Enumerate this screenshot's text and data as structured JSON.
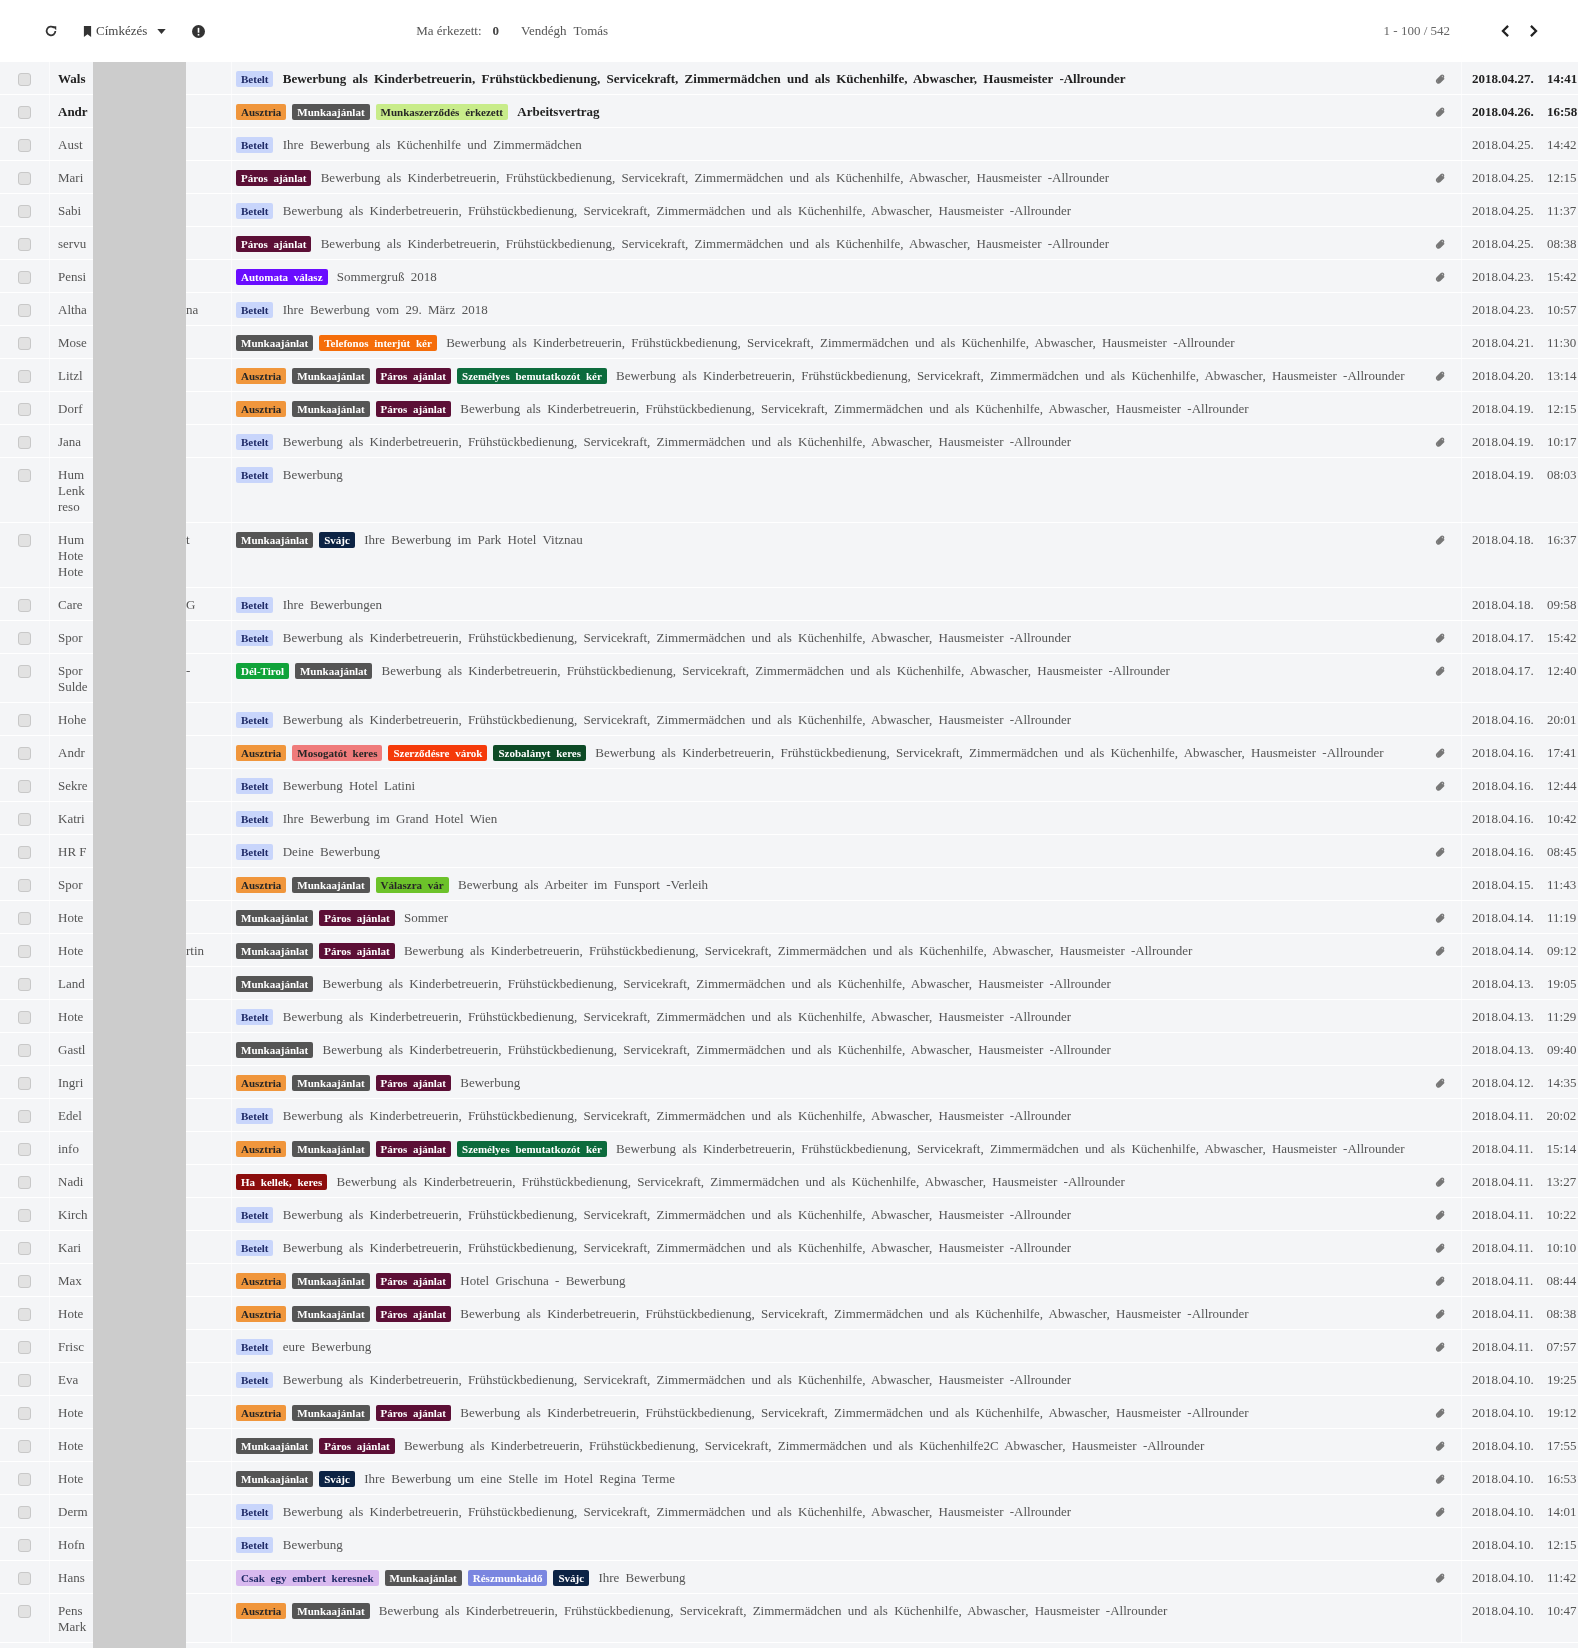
{
  "toolbar": {
    "label_menu": "Címkézés",
    "arrived_label": "Ma érkezett:",
    "arrived_count": "0",
    "user_name": "Vendégh Tomás",
    "pager": "1 - 100 / 542"
  },
  "rows": [
    {
      "sender_lines": [
        "Wals"
      ],
      "checked": false,
      "unread": true,
      "tags": [
        {
          "label": "Betelt",
          "color": "#c8d5fb"
        }
      ],
      "subject": "Bewerbung als Kinderbetreuerin, Frühstückbedienung, Servicekraft, Zimmermädchen und als Küchenhilfe, Abwascher, Hausmeister -Allrounder",
      "attachment": true,
      "date": "2018.04.27.",
      "time": "14:41"
    },
    {
      "sender_lines": [
        "Andr"
      ],
      "checked": false,
      "unread": true,
      "tags": [
        {
          "label": "Ausztria",
          "color": "#f0963c"
        },
        {
          "label": "Munkaajánlat",
          "color": "#555555"
        },
        {
          "label": "Munkaszerződés érkezett",
          "color": "#c8ec8a"
        }
      ],
      "subject": "Arbeitsvertrag",
      "attachment": true,
      "date": "2018.04.26.",
      "time": "16:58"
    },
    {
      "sender_lines": [
        "Aust"
      ],
      "checked": false,
      "unread": false,
      "tags": [
        {
          "label": "Betelt",
          "color": "#c8d5fb"
        }
      ],
      "subject": "Ihre Bewerbung als Küchenhilfe und Zimmermädchen",
      "attachment": false,
      "date": "2018.04.25.",
      "time": "14:42"
    },
    {
      "sender_lines": [
        "Mari"
      ],
      "checked": false,
      "unread": false,
      "tags": [
        {
          "label": "Páros ajánlat",
          "color": "#5c0f36"
        }
      ],
      "subject": "Bewerbung als Kinderbetreuerin, Frühstückbedienung, Servicekraft, Zimmermädchen und als Küchenhilfe, Abwascher, Hausmeister -Allrounder",
      "attachment": true,
      "date": "2018.04.25.",
      "time": "12:15"
    },
    {
      "sender_lines": [
        "Sabi"
      ],
      "checked": false,
      "unread": false,
      "tags": [
        {
          "label": "Betelt",
          "color": "#c8d5fb"
        }
      ],
      "subject": "Bewerbung als Kinderbetreuerin, Frühstückbedienung, Servicekraft, Zimmermädchen und als Küchenhilfe, Abwascher, Hausmeister -Allrounder",
      "attachment": false,
      "date": "2018.04.25.",
      "time": "11:37"
    },
    {
      "sender_lines": [
        "servu"
      ],
      "checked": false,
      "unread": false,
      "tags": [
        {
          "label": "Páros ajánlat",
          "color": "#5c0f36"
        }
      ],
      "subject": "Bewerbung als Kinderbetreuerin, Frühstückbedienung, Servicekraft, Zimmermädchen und als Küchenhilfe, Abwascher, Hausmeister -Allrounder",
      "attachment": true,
      "date": "2018.04.25.",
      "time": "08:38"
    },
    {
      "sender_lines": [
        "Pensi"
      ],
      "checked": false,
      "unread": false,
      "tags": [
        {
          "label": "Automata válasz",
          "color": "#6a0dff"
        }
      ],
      "subject": "Sommergruß 2018",
      "attachment": true,
      "date": "2018.04.23.",
      "time": "15:42"
    },
    {
      "sender_lines": [
        "Altha"
      ],
      "sender_tail": "na",
      "checked": false,
      "unread": false,
      "tags": [
        {
          "label": "Betelt",
          "color": "#c8d5fb"
        }
      ],
      "subject": "Ihre Bewerbung vom 29. März 2018",
      "attachment": false,
      "date": "2018.04.23.",
      "time": "10:57"
    },
    {
      "sender_lines": [
        "Mose"
      ],
      "checked": false,
      "unread": false,
      "tags": [
        {
          "label": "Munkaajánlat",
          "color": "#555555"
        },
        {
          "label": "Telefonos interjút kér",
          "color": "#f56d0a"
        }
      ],
      "subject": "Bewerbung als Kinderbetreuerin, Frühstückbedienung, Servicekraft, Zimmermädchen und als Küchenhilfe, Abwascher, Hausmeister -Allrounder",
      "attachment": false,
      "date": "2018.04.21.",
      "time": "11:30"
    },
    {
      "sender_lines": [
        "Litzl"
      ],
      "checked": false,
      "unread": false,
      "tags": [
        {
          "label": "Ausztria",
          "color": "#f0963c"
        },
        {
          "label": "Munkaajánlat",
          "color": "#555555"
        },
        {
          "label": "Páros ajánlat",
          "color": "#5c0f36"
        },
        {
          "label": "Személyes bemutatkozót kér",
          "color": "#0c6b3c"
        }
      ],
      "subject": "Bewerbung als Kinderbetreuerin, Frühstückbedienung, Servicekraft, Zimmermädchen und als Küchenhilfe, Abwascher, Hausmeister -Allrounder",
      "attachment": true,
      "date": "2018.04.20.",
      "time": "13:14"
    },
    {
      "sender_lines": [
        "Dorf"
      ],
      "checked": false,
      "unread": false,
      "tags": [
        {
          "label": "Ausztria",
          "color": "#f0963c"
        },
        {
          "label": "Munkaajánlat",
          "color": "#555555"
        },
        {
          "label": "Páros ajánlat",
          "color": "#5c0f36"
        }
      ],
      "subject": "Bewerbung als Kinderbetreuerin, Frühstückbedienung, Servicekraft, Zimmermädchen und als Küchenhilfe, Abwascher, Hausmeister -Allrounder",
      "attachment": false,
      "date": "2018.04.19.",
      "time": "12:15"
    },
    {
      "sender_lines": [
        "Jana"
      ],
      "checked": false,
      "unread": false,
      "tags": [
        {
          "label": "Betelt",
          "color": "#c8d5fb"
        }
      ],
      "subject": "Bewerbung als Kinderbetreuerin, Frühstückbedienung, Servicekraft, Zimmermädchen und als Küchenhilfe, Abwascher, Hausmeister -Allrounder",
      "attachment": true,
      "date": "2018.04.19.",
      "time": "10:17"
    },
    {
      "sender_lines": [
        "Hum",
        "Lenk",
        "reso"
      ],
      "checked": false,
      "unread": false,
      "tags": [
        {
          "label": "Betelt",
          "color": "#c8d5fb"
        }
      ],
      "subject": "Bewerbung",
      "attachment": false,
      "date": "2018.04.19.",
      "time": "08:03"
    },
    {
      "sender_lines": [
        "Hum",
        "Hote",
        "Hote"
      ],
      "sender_tail": "t",
      "checked": false,
      "unread": false,
      "tags": [
        {
          "label": "Munkaajánlat",
          "color": "#555555"
        },
        {
          "label": "Svájc",
          "color": "#0c2344"
        }
      ],
      "subject": "Ihre Bewerbung im Park Hotel Vitznau",
      "attachment": true,
      "date": "2018.04.18.",
      "time": "16:37"
    },
    {
      "sender_lines": [
        "Care"
      ],
      "sender_tail": "G",
      "checked": false,
      "unread": false,
      "tags": [
        {
          "label": "Betelt",
          "color": "#c8d5fb"
        }
      ],
      "subject": "Ihre Bewerbungen",
      "attachment": false,
      "date": "2018.04.18.",
      "time": "09:58"
    },
    {
      "sender_lines": [
        "Spor"
      ],
      "checked": false,
      "unread": false,
      "tags": [
        {
          "label": "Betelt",
          "color": "#c8d5fb"
        }
      ],
      "subject": "Bewerbung als Kinderbetreuerin, Frühstückbedienung, Servicekraft, Zimmermädchen und als Küchenhilfe, Abwascher, Hausmeister -Allrounder",
      "attachment": true,
      "date": "2018.04.17.",
      "time": "15:42"
    },
    {
      "sender_lines": [
        "Spor",
        "Sulde"
      ],
      "sender_tail": "-",
      "checked": false,
      "unread": false,
      "tags": [
        {
          "label": "Dél-Tirol",
          "color": "#10a33a"
        },
        {
          "label": "Munkaajánlat",
          "color": "#555555"
        }
      ],
      "subject": "Bewerbung als Kinderbetreuerin, Frühstückbedienung, Servicekraft, Zimmermädchen und als Küchenhilfe, Abwascher, Hausmeister -Allrounder",
      "attachment": true,
      "date": "2018.04.17.",
      "time": "12:40"
    },
    {
      "sender_lines": [
        "Hohe"
      ],
      "checked": false,
      "unread": false,
      "tags": [
        {
          "label": "Betelt",
          "color": "#c8d5fb"
        }
      ],
      "subject": "Bewerbung als Kinderbetreuerin, Frühstückbedienung, Servicekraft, Zimmermädchen und als Küchenhilfe, Abwascher, Hausmeister -Allrounder",
      "attachment": false,
      "date": "2018.04.16.",
      "time": "20:01"
    },
    {
      "sender_lines": [
        "Andr"
      ],
      "checked": false,
      "unread": false,
      "tags": [
        {
          "label": "Ausztria",
          "color": "#f0963c"
        },
        {
          "label": "Mosogatót keres",
          "color": "#ef7b7b"
        },
        {
          "label": "Szerződésre várok",
          "color": "#f53a0a"
        },
        {
          "label": "Szobalányt keres",
          "color": "#0d4a26"
        }
      ],
      "subject": "Bewerbung als Kinderbetreuerin, Frühstückbedienung, Servicekraft, Zimmermädchen und als Küchenhilfe, Abwascher, Hausmeister -Allrounder",
      "attachment": true,
      "date": "2018.04.16.",
      "time": "17:41"
    },
    {
      "sender_lines": [
        "Sekre"
      ],
      "checked": false,
      "unread": false,
      "tags": [
        {
          "label": "Betelt",
          "color": "#c8d5fb"
        }
      ],
      "subject": "Bewerbung Hotel Latini",
      "attachment": true,
      "date": "2018.04.16.",
      "time": "12:44"
    },
    {
      "sender_lines": [
        "Katri"
      ],
      "checked": false,
      "unread": false,
      "tags": [
        {
          "label": "Betelt",
          "color": "#c8d5fb"
        }
      ],
      "subject": "Ihre Bewerbung im Grand Hotel Wien",
      "attachment": false,
      "date": "2018.04.16.",
      "time": "10:42"
    },
    {
      "sender_lines": [
        "HR F"
      ],
      "checked": false,
      "unread": false,
      "tags": [
        {
          "label": "Betelt",
          "color": "#c8d5fb"
        }
      ],
      "subject": "Deine Bewerbung",
      "attachment": true,
      "date": "2018.04.16.",
      "time": "08:45"
    },
    {
      "sender_lines": [
        "Spor"
      ],
      "checked": false,
      "unread": false,
      "tags": [
        {
          "label": "Ausztria",
          "color": "#f0963c"
        },
        {
          "label": "Munkaajánlat",
          "color": "#555555"
        },
        {
          "label": "Válaszra vár",
          "color": "#6cc22a"
        }
      ],
      "subject": "Bewerbung als Arbeiter im Funsport -Verleih",
      "attachment": false,
      "date": "2018.04.15.",
      "time": "11:43"
    },
    {
      "sender_lines": [
        "Hote"
      ],
      "checked": false,
      "unread": false,
      "tags": [
        {
          "label": "Munkaajánlat",
          "color": "#555555"
        },
        {
          "label": "Páros ajánlat",
          "color": "#5c0f36"
        }
      ],
      "subject": "Sommer",
      "attachment": true,
      "date": "2018.04.14.",
      "time": "11:19"
    },
    {
      "sender_lines": [
        "Hote"
      ],
      "sender_tail": "rtin",
      "checked": false,
      "unread": false,
      "tags": [
        {
          "label": "Munkaajánlat",
          "color": "#555555"
        },
        {
          "label": "Páros ajánlat",
          "color": "#5c0f36"
        }
      ],
      "subject": "Bewerbung als Kinderbetreuerin, Frühstückbedienung, Servicekraft, Zimmermädchen und als Küchenhilfe, Abwascher, Hausmeister -Allrounder",
      "attachment": true,
      "date": "2018.04.14.",
      "time": "09:12"
    },
    {
      "sender_lines": [
        "Land"
      ],
      "checked": false,
      "unread": false,
      "tags": [
        {
          "label": "Munkaajánlat",
          "color": "#555555"
        }
      ],
      "subject": "Bewerbung als Kinderbetreuerin, Frühstückbedienung, Servicekraft, Zimmermädchen und als Küchenhilfe, Abwascher, Hausmeister -Allrounder",
      "attachment": false,
      "date": "2018.04.13.",
      "time": "19:05"
    },
    {
      "sender_lines": [
        "Hote"
      ],
      "checked": false,
      "unread": false,
      "tags": [
        {
          "label": "Betelt",
          "color": "#c8d5fb"
        }
      ],
      "subject": "Bewerbung als Kinderbetreuerin, Frühstückbedienung, Servicekraft, Zimmermädchen und als Küchenhilfe, Abwascher, Hausmeister -Allrounder",
      "attachment": false,
      "date": "2018.04.13.",
      "time": "11:29"
    },
    {
      "sender_lines": [
        "Gastl"
      ],
      "checked": false,
      "unread": false,
      "tags": [
        {
          "label": "Munkaajánlat",
          "color": "#555555"
        }
      ],
      "subject": "Bewerbung als Kinderbetreuerin, Frühstückbedienung, Servicekraft, Zimmermädchen und als Küchenhilfe, Abwascher, Hausmeister -Allrounder",
      "attachment": false,
      "date": "2018.04.13.",
      "time": "09:40"
    },
    {
      "sender_lines": [
        "Ingri"
      ],
      "checked": false,
      "unread": false,
      "tags": [
        {
          "label": "Ausztria",
          "color": "#f0963c"
        },
        {
          "label": "Munkaajánlat",
          "color": "#555555"
        },
        {
          "label": "Páros ajánlat",
          "color": "#5c0f36"
        }
      ],
      "subject": "Bewerbung",
      "attachment": true,
      "date": "2018.04.12.",
      "time": "14:35"
    },
    {
      "sender_lines": [
        "Edel"
      ],
      "checked": false,
      "unread": false,
      "tags": [
        {
          "label": "Betelt",
          "color": "#c8d5fb"
        }
      ],
      "subject": "Bewerbung als Kinderbetreuerin, Frühstückbedienung, Servicekraft, Zimmermädchen und als Küchenhilfe, Abwascher, Hausmeister -Allrounder",
      "attachment": false,
      "date": "2018.04.11.",
      "time": "20:02"
    },
    {
      "sender_lines": [
        "info"
      ],
      "checked": false,
      "unread": false,
      "tags": [
        {
          "label": "Ausztria",
          "color": "#f0963c"
        },
        {
          "label": "Munkaajánlat",
          "color": "#555555"
        },
        {
          "label": "Páros ajánlat",
          "color": "#5c0f36"
        },
        {
          "label": "Személyes bemutatkozót kér",
          "color": "#0c6b3c"
        }
      ],
      "subject": "Bewerbung als Kinderbetreuerin, Frühstückbedienung, Servicekraft, Zimmermädchen und als Küchenhilfe, Abwascher, Hausmeister -Allrounder",
      "attachment": false,
      "date": "2018.04.11.",
      "time": "15:14"
    },
    {
      "sender_lines": [
        "Nadi"
      ],
      "checked": false,
      "unread": false,
      "tags": [
        {
          "label": "Ha kellek, keres",
          "color": "#8c0d0d"
        }
      ],
      "subject": "Bewerbung als Kinderbetreuerin, Frühstückbedienung, Servicekraft, Zimmermädchen und als Küchenhilfe, Abwascher, Hausmeister -Allrounder",
      "attachment": true,
      "date": "2018.04.11.",
      "time": "13:27"
    },
    {
      "sender_lines": [
        "Kirch"
      ],
      "checked": false,
      "unread": false,
      "tags": [
        {
          "label": "Betelt",
          "color": "#c8d5fb"
        }
      ],
      "subject": "Bewerbung als Kinderbetreuerin, Frühstückbedienung, Servicekraft, Zimmermädchen und als Küchenhilfe, Abwascher, Hausmeister -Allrounder",
      "attachment": true,
      "date": "2018.04.11.",
      "time": "10:22"
    },
    {
      "sender_lines": [
        "Kari"
      ],
      "checked": false,
      "unread": false,
      "tags": [
        {
          "label": "Betelt",
          "color": "#c8d5fb"
        }
      ],
      "subject": "Bewerbung als Kinderbetreuerin, Frühstückbedienung, Servicekraft, Zimmermädchen und als Küchenhilfe, Abwascher, Hausmeister -Allrounder",
      "attachment": true,
      "date": "2018.04.11.",
      "time": "10:10"
    },
    {
      "sender_lines": [
        "Max"
      ],
      "checked": false,
      "unread": false,
      "tags": [
        {
          "label": "Ausztria",
          "color": "#f0963c"
        },
        {
          "label": "Munkaajánlat",
          "color": "#555555"
        },
        {
          "label": "Páros ajánlat",
          "color": "#5c0f36"
        }
      ],
      "subject": "Hotel Grischuna - Bewerbung",
      "attachment": true,
      "date": "2018.04.11.",
      "time": "08:44"
    },
    {
      "sender_lines": [
        "Hote"
      ],
      "checked": false,
      "unread": false,
      "tags": [
        {
          "label": "Ausztria",
          "color": "#f0963c"
        },
        {
          "label": "Munkaajánlat",
          "color": "#555555"
        },
        {
          "label": "Páros ajánlat",
          "color": "#5c0f36"
        }
      ],
      "subject": "Bewerbung als Kinderbetreuerin, Frühstückbedienung, Servicekraft, Zimmermädchen und als Küchenhilfe, Abwascher, Hausmeister -Allrounder",
      "attachment": true,
      "date": "2018.04.11.",
      "time": "08:38"
    },
    {
      "sender_lines": [
        "Frisc"
      ],
      "checked": false,
      "unread": false,
      "tags": [
        {
          "label": "Betelt",
          "color": "#c8d5fb"
        }
      ],
      "subject": "eure Bewerbung",
      "attachment": true,
      "date": "2018.04.11.",
      "time": "07:57"
    },
    {
      "sender_lines": [
        "Eva"
      ],
      "checked": false,
      "unread": false,
      "tags": [
        {
          "label": "Betelt",
          "color": "#c8d5fb"
        }
      ],
      "subject": "Bewerbung als Kinderbetreuerin, Frühstückbedienung, Servicekraft, Zimmermädchen und als Küchenhilfe, Abwascher, Hausmeister -Allrounder",
      "attachment": false,
      "date": "2018.04.10.",
      "time": "19:25"
    },
    {
      "sender_lines": [
        "Hote"
      ],
      "checked": false,
      "unread": false,
      "tags": [
        {
          "label": "Ausztria",
          "color": "#f0963c"
        },
        {
          "label": "Munkaajánlat",
          "color": "#555555"
        },
        {
          "label": "Páros ajánlat",
          "color": "#5c0f36"
        }
      ],
      "subject": "Bewerbung als Kinderbetreuerin, Frühstückbedienung, Servicekraft, Zimmermädchen und als Küchenhilfe, Abwascher, Hausmeister -Allrounder",
      "attachment": true,
      "date": "2018.04.10.",
      "time": "19:12"
    },
    {
      "sender_lines": [
        "Hote"
      ],
      "checked": false,
      "unread": false,
      "tags": [
        {
          "label": "Munkaajánlat",
          "color": "#555555"
        },
        {
          "label": "Páros ajánlat",
          "color": "#5c0f36"
        }
      ],
      "subject": "Bewerbung als Kinderbetreuerin, Frühstückbedienung, Servicekraft, Zimmermädchen und als Küchenhilfe2C Abwascher, Hausmeister -Allrounder",
      "attachment": true,
      "date": "2018.04.10.",
      "time": "17:55"
    },
    {
      "sender_lines": [
        "Hote"
      ],
      "checked": false,
      "unread": false,
      "tags": [
        {
          "label": "Munkaajánlat",
          "color": "#555555"
        },
        {
          "label": "Svájc",
          "color": "#0c2344"
        }
      ],
      "subject": "Ihre Bewerbung um eine Stelle im Hotel Regina Terme",
      "attachment": true,
      "date": "2018.04.10.",
      "time": "16:53"
    },
    {
      "sender_lines": [
        "Derm"
      ],
      "checked": false,
      "unread": false,
      "tags": [
        {
          "label": "Betelt",
          "color": "#c8d5fb"
        }
      ],
      "subject": "Bewerbung als Kinderbetreuerin, Frühstückbedienung, Servicekraft, Zimmermädchen und als Küchenhilfe, Abwascher, Hausmeister -Allrounder",
      "attachment": true,
      "date": "2018.04.10.",
      "time": "14:01"
    },
    {
      "sender_lines": [
        "Hofn"
      ],
      "checked": false,
      "unread": false,
      "tags": [
        {
          "label": "Betelt",
          "color": "#c8d5fb"
        }
      ],
      "subject": "Bewerbung",
      "attachment": false,
      "date": "2018.04.10.",
      "time": "12:15"
    },
    {
      "sender_lines": [
        "Hans"
      ],
      "checked": false,
      "unread": false,
      "tags": [
        {
          "label": "Csak egy embert keresnek",
          "color": "#d8b9ef"
        },
        {
          "label": "Munkaajánlat",
          "color": "#555555"
        },
        {
          "label": "Részmunkaidő",
          "color": "#7a86e0"
        },
        {
          "label": "Svájc",
          "color": "#0c2344"
        }
      ],
      "subject": "Ihre Bewerbung",
      "attachment": true,
      "date": "2018.04.10.",
      "time": "11:42"
    },
    {
      "sender_lines": [
        "Pens",
        "Mark"
      ],
      "checked": false,
      "unread": false,
      "tags": [
        {
          "label": "Ausztria",
          "color": "#f0963c"
        },
        {
          "label": "Munkaajánlat",
          "color": "#555555"
        }
      ],
      "subject": "Bewerbung als Kinderbetreuerin, Frühstückbedienung, Servicekraft, Zimmermädchen und als Küchenhilfe, Abwascher, Hausmeister -Allrounder",
      "attachment": false,
      "date": "2018.04.10.",
      "time": "10:47"
    }
  ]
}
